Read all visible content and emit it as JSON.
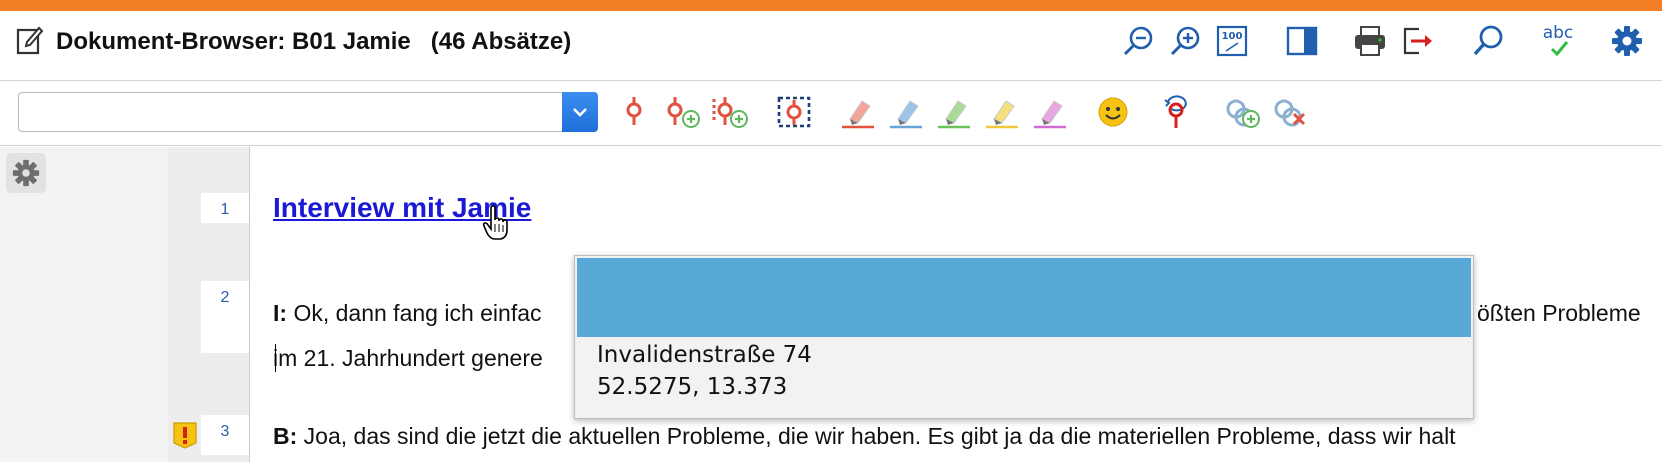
{
  "window": {
    "title": "Dokument-Browser: B01 Jamie   (46 Absätze)",
    "accent_color": "#f57f25"
  },
  "titlebar_icons": [
    "zoom-out-icon",
    "zoom-in-icon",
    "zoom-100-icon",
    "panel-toggle-icon",
    "print-icon",
    "export-icon",
    "search-icon",
    "spellcheck-icon",
    "settings-gear-icon"
  ],
  "spellcheck_label": "abc",
  "zoom100_label": "100",
  "toolbar": {
    "code_selector_value": "",
    "icons": [
      "code-icon",
      "add-code-icon",
      "add-multiple-codes-icon",
      "code-selection-icon",
      "red-highlighter-icon",
      "blue-highlighter-icon",
      "green-highlighter-icon",
      "yellow-highlighter-icon",
      "magenta-highlighter-icon",
      "emoticode-smiley-icon",
      "reset-code-icon",
      "add-link-icon",
      "remove-link-icon"
    ]
  },
  "paragraphs": [
    {
      "number": "1",
      "text": "Interview mit Jamie"
    },
    {
      "number": "2",
      "speaker": "I:",
      "line1": " Ok, dann fang ich einfac",
      "line1_end": "ößten Probleme",
      "line2": "im 21. Jahrhundert genere"
    },
    {
      "number": "3",
      "speaker": "B:",
      "line1": " Joa, das sind die jetzt die aktuellen Probleme, die wir haben. Es gibt ja da die materiellen Probleme, dass wir halt"
    }
  ],
  "popup": {
    "street": "Invalidenstraße 74",
    "coordinates": "52.5275, 13.373",
    "header_color": "#58a8d8"
  }
}
